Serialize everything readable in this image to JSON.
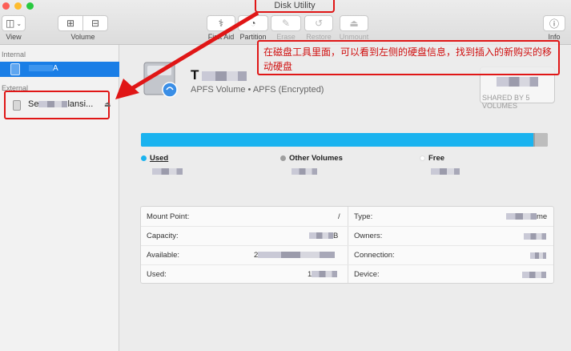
{
  "window": {
    "title": "Disk Utility"
  },
  "toolbar": {
    "view_label": "View",
    "volume_label": "Volume",
    "first_aid_label": "First Aid",
    "partition_label": "Partition",
    "erase_label": "Erase",
    "restore_label": "Restore",
    "unmount_label": "Unmount",
    "info_label": "Info"
  },
  "sidebar": {
    "internal_header": "Internal",
    "internal_item": "A",
    "external_header": "External",
    "external_item_prefix": "Se",
    "external_item_suffix": "lansi..."
  },
  "volume": {
    "name": "T",
    "subtitle": "APFS Volume • APFS (Encrypted)",
    "size_caption": "SHARED BY 5 VOLUMES"
  },
  "annotation": {
    "text": "在磁盘工具里面，可以看到左侧的硬盘信息，找到插入的新购买的移动硬盘"
  },
  "usage": {
    "used_fraction": 0.965,
    "legend": [
      {
        "label": "Used",
        "color": "#1ab3ef"
      },
      {
        "label": "Other Volumes",
        "color": "#9f9f9f"
      },
      {
        "label": "Free",
        "color": "#ffffff"
      }
    ]
  },
  "info": {
    "left": [
      {
        "key": "Mount Point:",
        "value": "/"
      },
      {
        "key": "Capacity:",
        "value": "B"
      },
      {
        "key": "Available:",
        "value": "2"
      },
      {
        "key": "Used:",
        "value": "1"
      }
    ],
    "right": [
      {
        "key": "Type:",
        "value": "me"
      },
      {
        "key": "Owners:",
        "value": ""
      },
      {
        "key": "Connection:",
        "value": ""
      },
      {
        "key": "Device:",
        "value": ""
      }
    ]
  }
}
